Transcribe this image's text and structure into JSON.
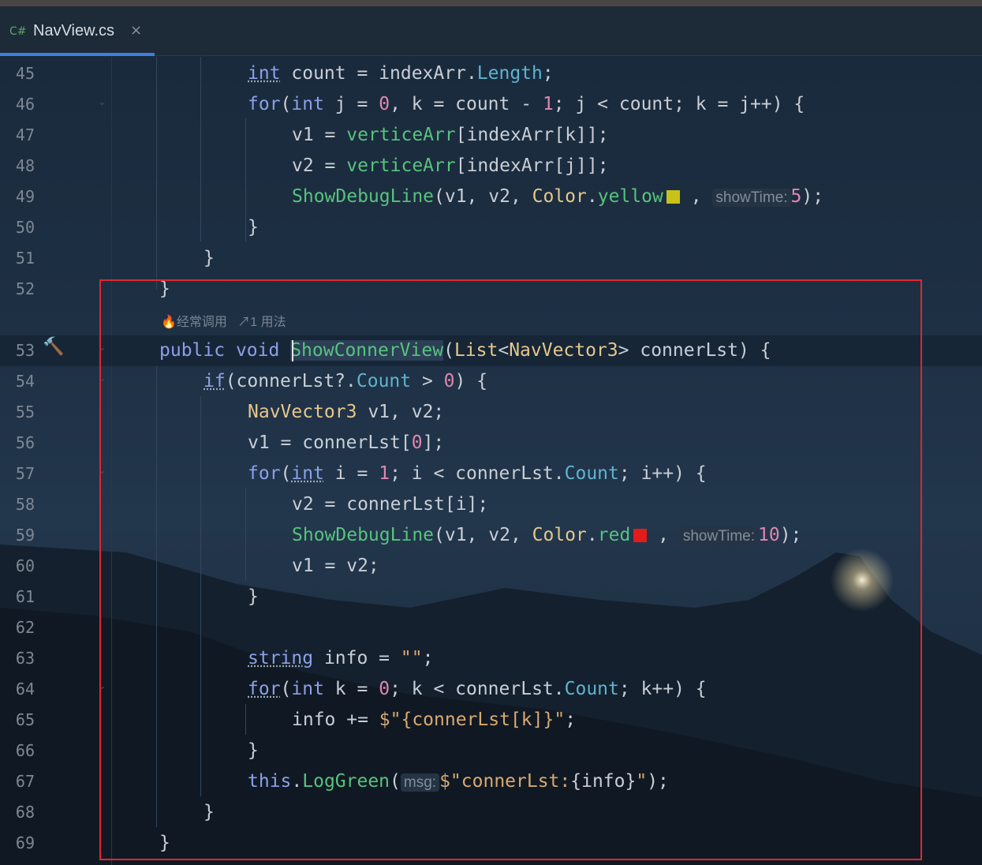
{
  "tab": {
    "lang": "C#",
    "filename": "NavView.cs",
    "close": "×"
  },
  "codelens": {
    "usage_hint": "经常调用",
    "usage_count": "1 用法"
  },
  "inlay_hints": {
    "showtime": "showTime:",
    "msg": "msg:"
  },
  "colors": {
    "yellow_swatch": "#c8c218",
    "red_swatch": "#e21b1b",
    "highlight_box": "#e0262f",
    "tab_accent": "#3d7fe0"
  },
  "icons": [
    "hammer-icon",
    "fold-chevron-icon",
    "fire-icon",
    "link-icon"
  ],
  "lines": [
    {
      "n": "45"
    },
    {
      "n": "46"
    },
    {
      "n": "47"
    },
    {
      "n": "48"
    },
    {
      "n": "49"
    },
    {
      "n": "50"
    },
    {
      "n": "51"
    },
    {
      "n": "52"
    },
    {
      "n": "53"
    },
    {
      "n": "54"
    },
    {
      "n": "55"
    },
    {
      "n": "56"
    },
    {
      "n": "57"
    },
    {
      "n": "58"
    },
    {
      "n": "59"
    },
    {
      "n": "60"
    },
    {
      "n": "61"
    },
    {
      "n": "62"
    },
    {
      "n": "63"
    },
    {
      "n": "64"
    },
    {
      "n": "65"
    },
    {
      "n": "66"
    },
    {
      "n": "67"
    },
    {
      "n": "68"
    },
    {
      "n": "69"
    }
  ],
  "code": {
    "l45": {
      "kw": "int",
      "a": " count = indexArr.",
      "pr": "Length",
      "b": ";"
    },
    "l46": {
      "kw1": "for",
      "a": "(",
      "kw2": "int",
      "b": " j = ",
      "n0": "0",
      "c": ", k = count - ",
      "n1": "1",
      "d": "; j < count; k = j++) {"
    },
    "l47": {
      "a": "v1 = ",
      "mt": "verticeArr",
      "b": "[indexArr[k]];"
    },
    "l48": {
      "a": "v2 = ",
      "mt": "verticeArr",
      "b": "[indexArr[j]];"
    },
    "l49": {
      "mt": "ShowDebugLine",
      "a": "(v1, v2, ",
      "ty": "Color",
      "b": ".",
      "pr": "yellow",
      "c": " , ",
      "n": "5",
      "d": ");"
    },
    "l50": {
      "a": "}"
    },
    "l51": {
      "a": "}"
    },
    "l52": {
      "a": "}"
    },
    "l53": {
      "kw1": "public",
      "kw2": "void",
      "mt": "ShowConnerView",
      "a": "(",
      "ty1": "List",
      "b": "<",
      "ty2": "NavVector3",
      "c": "> connerLst) {"
    },
    "l54": {
      "kw": "if",
      "a": "(connerLst?.",
      "pr": "Count",
      "b": " > ",
      "n": "0",
      "c": ") {"
    },
    "l55": {
      "ty": "NavVector3",
      "a": " v1, v2;"
    },
    "l56": {
      "a": "v1 = connerLst[",
      "n": "0",
      "b": "];"
    },
    "l57": {
      "kw1": "for",
      "a": "(",
      "kw2": "int",
      "b": " i = ",
      "n": "1",
      "c": "; i < connerLst.",
      "pr": "Count",
      "d": "; i++) {"
    },
    "l58": {
      "a": "v2 = connerLst[i];"
    },
    "l59": {
      "mt": "ShowDebugLine",
      "a": "(v1, v2, ",
      "ty": "Color",
      "b": ".",
      "pr": "red",
      "c": " , ",
      "n": "10",
      "d": ");"
    },
    "l60": {
      "a": "v1 = v2;"
    },
    "l61": {
      "a": "}"
    },
    "l63": {
      "kw": "string",
      "a": " info = ",
      "st": "\"\"",
      "b": ";"
    },
    "l64": {
      "kw1": "for",
      "a": "(",
      "kw2": "int",
      "b": " k = ",
      "n": "0",
      "c": "; k < connerLst.",
      "pr": "Count",
      "d": "; k++) {"
    },
    "l65": {
      "a": "info += ",
      "st1": "$\"",
      "b": "{connerLst[k]}",
      "st2": "\"",
      "c": ";"
    },
    "l66": {
      "a": "}"
    },
    "l67": {
      "kw": "this",
      "a": ".",
      "mt": "LogGreen",
      "b": "(",
      "st1": "$\"connerLst:",
      "c": "{info}",
      "st2": "\"",
      "d": ");"
    },
    "l68": {
      "a": "}"
    },
    "l69": {
      "a": "}"
    }
  }
}
